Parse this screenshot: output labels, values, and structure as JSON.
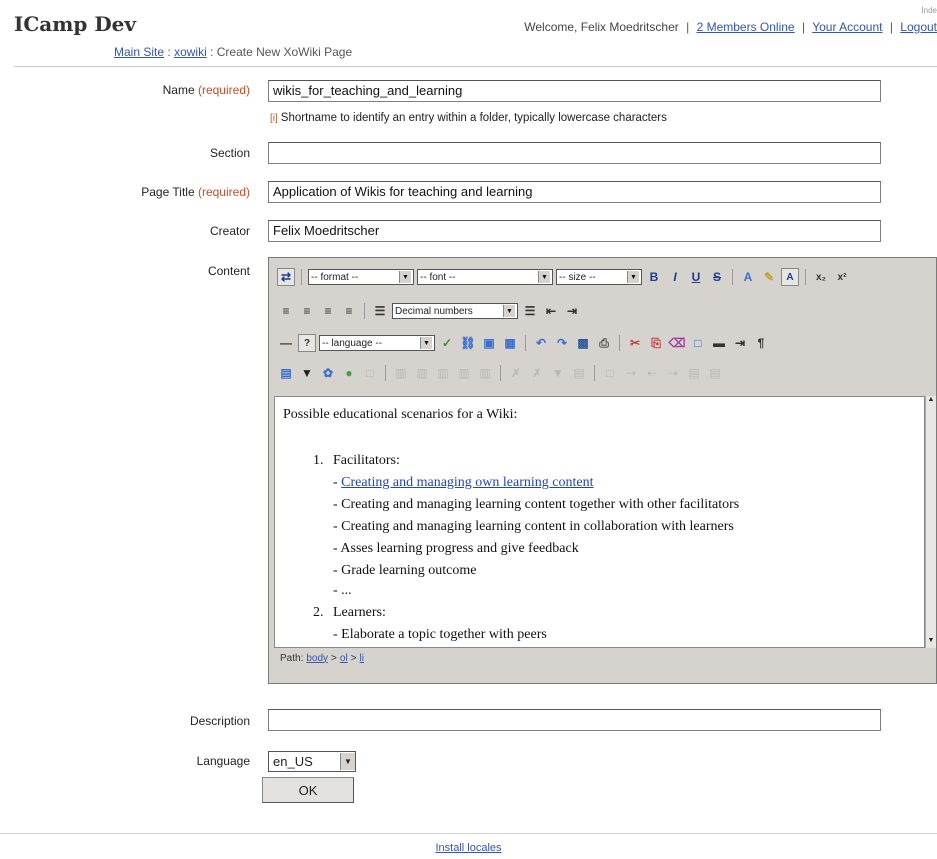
{
  "header": {
    "site_title": "ICamp Dev",
    "welcome": "Welcome, Felix Moedritscher",
    "members_online": "2 Members Online",
    "your_account": "Your Account",
    "logout": "Logout",
    "tiny_text": "Inde"
  },
  "breadcrumb": {
    "main_site": "Main Site",
    "xowiki": "xowiki",
    "current": "Create New XoWiki Page",
    "sep": ":"
  },
  "form": {
    "name_label": "Name",
    "required_text": "(required)",
    "name_value": "wikis_for_teaching_and_learning",
    "name_hint_icon": "[i]",
    "name_hint": "Shortname to identify an entry within a folder, typically lowercase characters",
    "section_label": "Section",
    "section_value": "",
    "page_title_label": "Page Title",
    "page_title_value": "Application of Wikis for teaching and learning",
    "creator_label": "Creator",
    "creator_value": "Felix Moedritscher",
    "content_label": "Content",
    "description_label": "Description",
    "description_value": "",
    "language_label": "Language",
    "language_value": "en_US",
    "ok_label": "OK"
  },
  "editor": {
    "format_select": "-- format --",
    "font_select": "-- font --",
    "size_select": "-- size --",
    "list_type_select": "Decimal numbers",
    "language_select": "-- language --",
    "intro": "Possible educational scenarios for a Wiki:",
    "item1_num": "1.",
    "item1_title": "Facilitators:",
    "item1_link": "Creating and managing own learning content",
    "item1_lines": [
      "- Creating and managing learning content together with other facilitators",
      "- Creating and managing learning content in collaboration with learners",
      "- Asses learning progress and give feedback",
      "- Grade learning outcome",
      "- ..."
    ],
    "item1_link_prefix": "- ",
    "item2_num": "2.",
    "item2_title": "Learners:",
    "item2_lines": [
      "- Elaborate a topic together with peers"
    ],
    "path_label": "Path:",
    "path_body": "body",
    "path_ol": "ol",
    "path_li": "li",
    "path_sep": ">"
  },
  "footer": {
    "install_locales": "Install locales"
  }
}
